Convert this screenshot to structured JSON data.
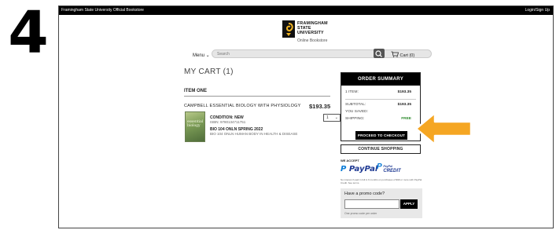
{
  "step_number": "4",
  "topbar": {
    "store_name": "Framingham State University Official Bookstore",
    "login": "Login/Sign Up"
  },
  "logo": {
    "line1": "FRAMINGHAM",
    "line2": "STATE",
    "line3": "UNIVERSITY",
    "subtitle": "Online Bookstore"
  },
  "nav": {
    "menu_label": "Menu",
    "search_placeholder": "Search",
    "cart_label": "Cart (0)"
  },
  "cart": {
    "title": "MY CART (1)",
    "item_heading": "ITEM ONE",
    "item": {
      "title": "CAMPBELL ESSENTIAL BIOLOGY WITH PHYSIOLOGY",
      "price": "$193.35",
      "quantity": "1",
      "cover_text": "essential biology",
      "condition": "CONDITION: NEW",
      "isbn": "ISBN: 9780134711751",
      "course": "BIO 104 ONLN  SPRING 2022",
      "course_desc": "BIO 104 ONLN HUMAN BODY IN HEALTH & DISEASE"
    }
  },
  "summary": {
    "header": "ORDER SUMMARY",
    "items_label": "1 ITEM:",
    "items_value": "$193.35",
    "subtotal_label": "SUBTOTAL:",
    "subtotal_value": "$193.35",
    "saved_label": "YOU SAVED:",
    "shipping_label": "SHIPPING:",
    "shipping_value": "FREE",
    "checkout_label": "PROCEED TO CHECKOUT"
  },
  "continue_label": "CONTINUE SHOPPING",
  "payment": {
    "we_accept": "WE ACCEPT",
    "paypal": "PayPal",
    "paypal_credit_top": "PayPal",
    "paypal_credit": "CREDIT",
    "fine_print": "No interest if paid in full in 6 months on purchases of $99 or more with PayPal Credit. See terms."
  },
  "promo": {
    "label": "Have a promo code?",
    "apply": "APPLY",
    "note": "One promo code per order"
  },
  "colors": {
    "accent_arrow": "#f5a623",
    "shipping_free": "#2e8b2e",
    "paypal_blue": "#1f3a93"
  }
}
